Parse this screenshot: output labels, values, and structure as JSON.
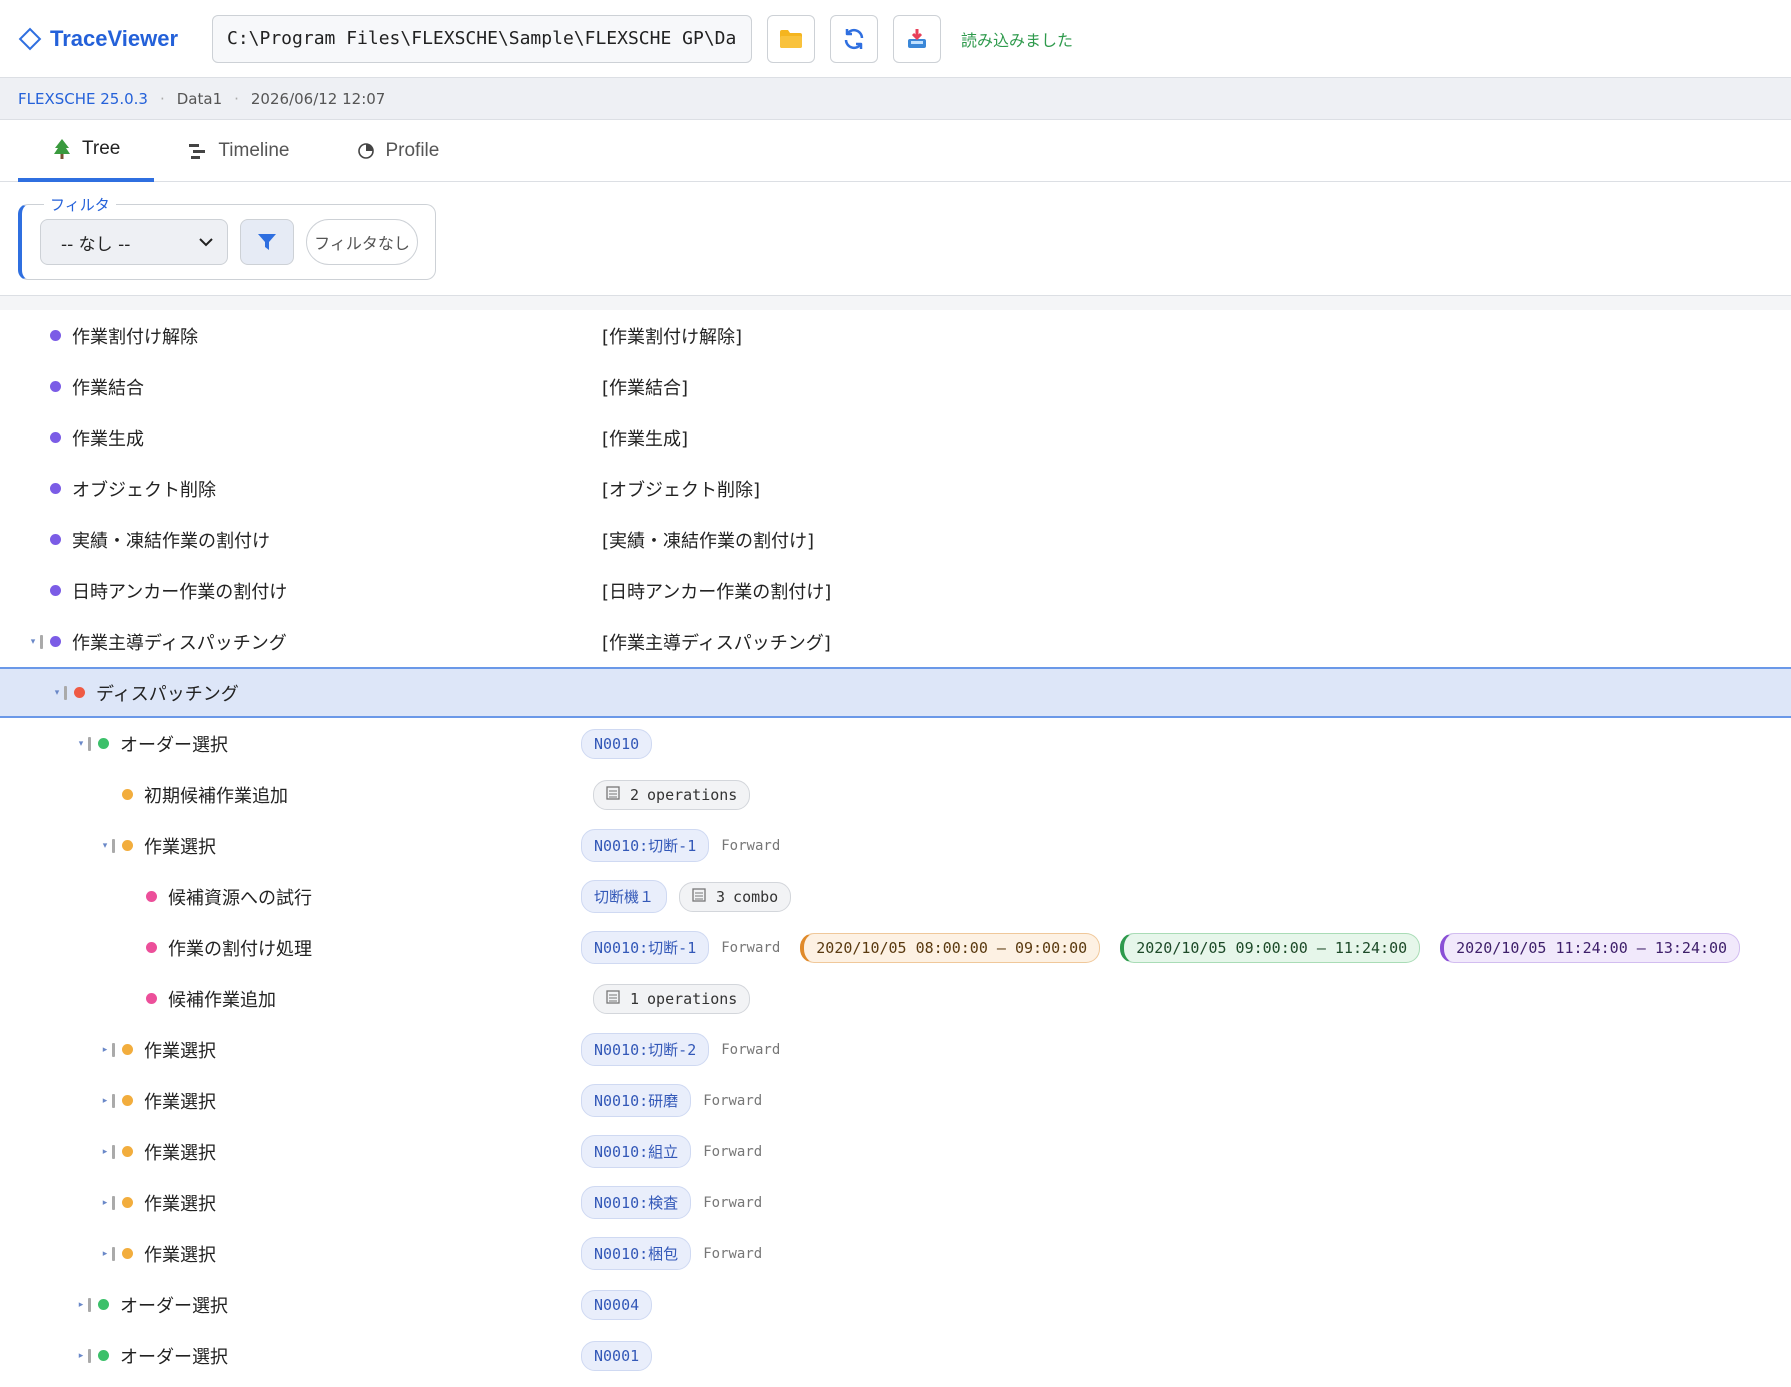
{
  "header": {
    "title": "TraceViewer",
    "path_value": "C:\\Program Files\\FLEXSCHE\\Sample\\FLEXSCHE GP\\Dat",
    "open_button": "folder-icon",
    "reload_button": "refresh-icon",
    "import_button": "import-icon",
    "status": "読み込みました"
  },
  "infobar": {
    "version": "FLEXSCHE 25.0.3",
    "dataset": "Data1",
    "timestamp": "2026/06/12 12:07",
    "separator": "·"
  },
  "tabs": [
    {
      "label": "Tree",
      "icon": "tree-icon",
      "active": true
    },
    {
      "label": "Timeline",
      "icon": "timeline-icon",
      "active": false
    },
    {
      "label": "Profile",
      "icon": "pie-icon",
      "active": false
    }
  ],
  "filter": {
    "legend": "フィルタ",
    "selected": "-- なし --",
    "clear_label": "フィルタなし"
  },
  "colors": {
    "accent": "#2f6fe0",
    "dot_purple": "#7b5ce6",
    "dot_red": "#ef5a44",
    "dot_green": "#3cc06a",
    "dot_orange": "#f2ad3d",
    "dot_pink": "#ec4f9a"
  },
  "rows": [
    {
      "name": "作業割付け解除",
      "detail": "[作業割付け解除]"
    },
    {
      "name": "作業結合",
      "detail": "[作業結合]"
    },
    {
      "name": "作業生成",
      "detail": "[作業生成]"
    },
    {
      "name": "オブジェクト削除",
      "detail": "[オブジェクト削除]"
    },
    {
      "name": "実績・凍結作業の割付け",
      "detail": "[実績・凍結作業の割付け]"
    },
    {
      "name": "日時アンカー作業の割付け",
      "detail": "[日時アンカー作業の割付け]"
    },
    {
      "name": "作業主導ディスパッチング",
      "detail": "[作業主導ディスパッチング]",
      "toggle": "▾"
    },
    {
      "name": "ディスパッチング",
      "toggle": "▾"
    },
    {
      "name": "オーダー選択",
      "chip": "N0010",
      "toggle": "▾"
    },
    {
      "name": "初期候補作業追加",
      "pill_count": "2",
      "pill_unit": "operations"
    },
    {
      "name": "作業選択",
      "chip": "N0010:切断-1",
      "direction": "Forward",
      "toggle": "▾"
    },
    {
      "name": "候補資源への試行",
      "chip": "切断機１",
      "pill_count": "3",
      "pill_unit": "combo"
    },
    {
      "name": "作業の割付け処理",
      "chip": "N0010:切断-1",
      "direction": "Forward",
      "times": [
        "2020/10/05 08:00:00 – 09:00:00",
        "2020/10/05 09:00:00 – 11:24:00",
        "2020/10/05 11:24:00 – 13:24:00"
      ]
    },
    {
      "name": "候補作業追加",
      "pill_count": "1",
      "pill_unit": "operations"
    },
    {
      "name": "作業選択",
      "chip": "N0010:切断-2",
      "direction": "Forward",
      "toggle": "▸"
    },
    {
      "name": "作業選択",
      "chip": "N0010:研磨",
      "direction": "Forward",
      "toggle": "▸"
    },
    {
      "name": "作業選択",
      "chip": "N0010:組立",
      "direction": "Forward",
      "toggle": "▸"
    },
    {
      "name": "作業選択",
      "chip": "N0010:検査",
      "direction": "Forward",
      "toggle": "▸"
    },
    {
      "name": "作業選択",
      "chip": "N0010:梱包",
      "direction": "Forward",
      "toggle": "▸"
    },
    {
      "name": "オーダー選択",
      "chip": "N0004",
      "toggle": "▸"
    },
    {
      "name": "オーダー選択",
      "chip": "N0001",
      "toggle": "▸"
    }
  ]
}
